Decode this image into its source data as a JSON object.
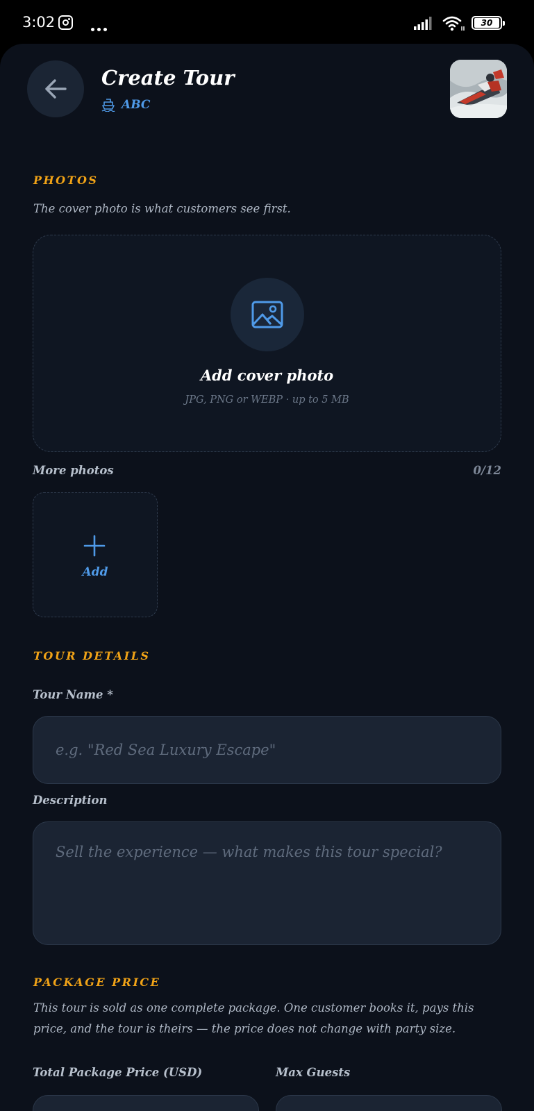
{
  "status_bar": {
    "time": "3:02",
    "battery": "30"
  },
  "header": {
    "title": "Create Tour",
    "operator_name": "ABC"
  },
  "photos": {
    "section_label": "PHOTOS",
    "helper": "The cover photo is what customers see first.",
    "cover_title": "Add cover photo",
    "cover_subtitle": "JPG, PNG or WEBP · up to 5 MB",
    "more_label": "More photos",
    "count": "0/12",
    "add_label": "Add"
  },
  "tour_details": {
    "section_label": "TOUR DETAILS",
    "name_label": "Tour Name *",
    "name_placeholder": "e.g. \"Red Sea Luxury Escape\"",
    "name_value": "",
    "description_label": "Description",
    "description_placeholder": "Sell the experience — what makes this tour special?",
    "description_value": ""
  },
  "package_price": {
    "section_label": "PACKAGE PRICE",
    "helper_line1": "This tour is sold as one complete package. One customer books it, pays this",
    "helper_line2": "price, and the tour is theirs — the price does not change with party size.",
    "price_label": "Total Package Price (USD)",
    "guests_label": "Max Guests"
  },
  "colors": {
    "background": "#0c111b",
    "accent_orange": "#f1a317",
    "accent_blue": "#4f9ae8",
    "input_bg": "#1b2433"
  },
  "icons": {
    "back": "arrow-left-icon",
    "operator": "ship-icon",
    "cover": "image-icon",
    "add": "plus-icon"
  }
}
